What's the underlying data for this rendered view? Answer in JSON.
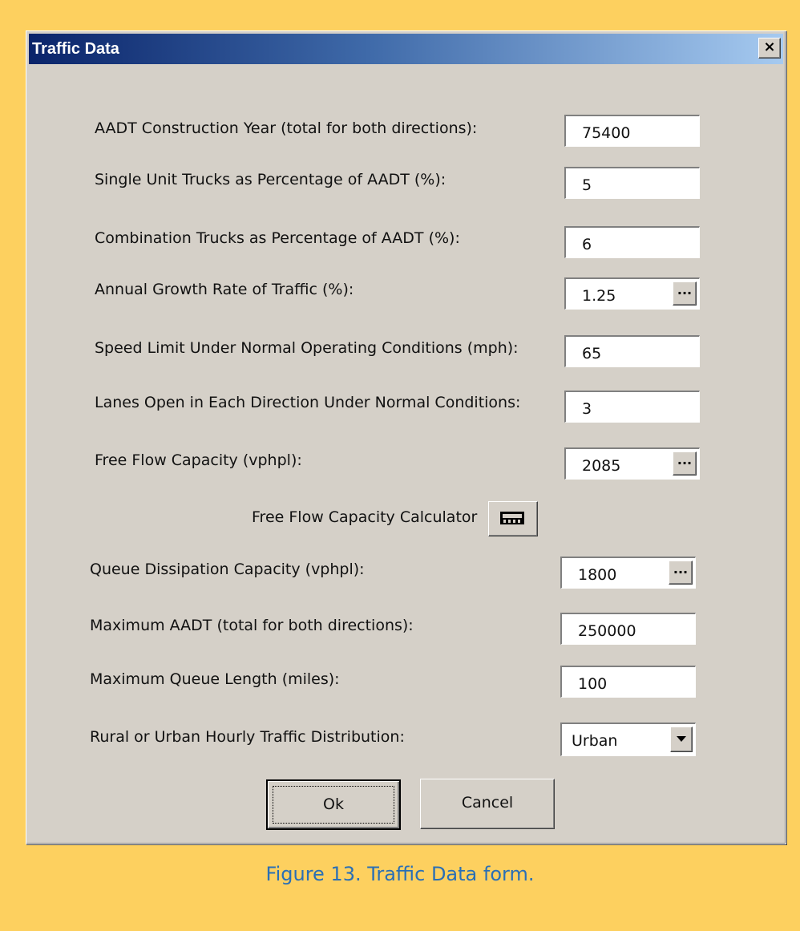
{
  "window": {
    "title": "Traffic Data",
    "close_glyph": "×"
  },
  "fields": [
    {
      "label": "AADT Construction Year (total for both directions):",
      "value": "75400"
    },
    {
      "label": "Single Unit Trucks as Percentage of AADT (%):",
      "value": "5"
    },
    {
      "label": "Combination Trucks as Percentage of AADT (%):",
      "value": "6"
    },
    {
      "label": "Annual Growth Rate of Traffic (%):",
      "value": "1.25",
      "button": "..."
    },
    {
      "label": "Speed Limit Under Normal Operating Conditions (mph):",
      "value": "65"
    },
    {
      "label": "Lanes Open in Each Direction Under Normal Conditions:",
      "value": "3"
    },
    {
      "label": "Free Flow Capacity (vphpl):",
      "value": "2085",
      "button": "..."
    },
    {
      "label": "Queue Dissipation Capacity (vphpl):",
      "value": "1800",
      "button": "..."
    },
    {
      "label": "Maximum AADT (total for both directions):",
      "value": "250000"
    },
    {
      "label": "Maximum Queue Length (miles):",
      "value": "100"
    },
    {
      "label": "Rural or Urban Hourly Traffic Distribution:",
      "value": "Urban"
    }
  ],
  "calculator": {
    "label": "Free Flow Capacity Calculator",
    "icon": "calculator-icon"
  },
  "buttons": {
    "ok": "Ok",
    "cancel": "Cancel"
  },
  "caption": "Figure 13. Traffic Data form."
}
